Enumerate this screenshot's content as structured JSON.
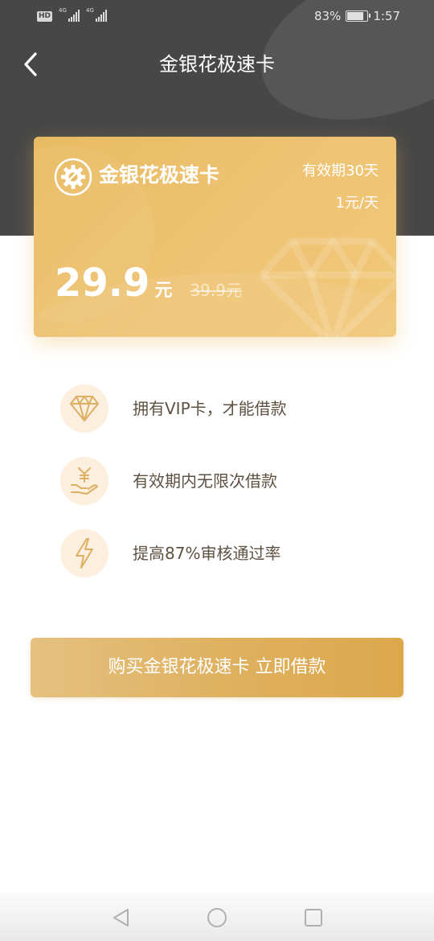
{
  "status_bar": {
    "hd": "HD",
    "net1": "4G",
    "net2": "4G",
    "battery": "83%",
    "battery_level": 0.83,
    "time": "1:57"
  },
  "nav": {
    "title": "金银花极速卡"
  },
  "card": {
    "title": "金银花极速卡",
    "validity": "有效期30天",
    "daily": "1元/天",
    "price": "29.9",
    "unit": "元",
    "original_price": "39.9元"
  },
  "features": [
    {
      "icon": "diamond-icon",
      "text": "拥有VIP卡，才能借款"
    },
    {
      "icon": "money-hand-icon",
      "text": "有效期内无限次借款"
    },
    {
      "icon": "lightning-icon",
      "text": "提高87%审核通过率"
    }
  ],
  "buy_button": {
    "label": "购买金银花极速卡 立即借款"
  },
  "colors": {
    "header_bg": "#474747",
    "card_gold": "#edc070",
    "feature_text": "#5e5142",
    "icon_stroke": "#deae63",
    "icon_bg": "#fcefde"
  }
}
